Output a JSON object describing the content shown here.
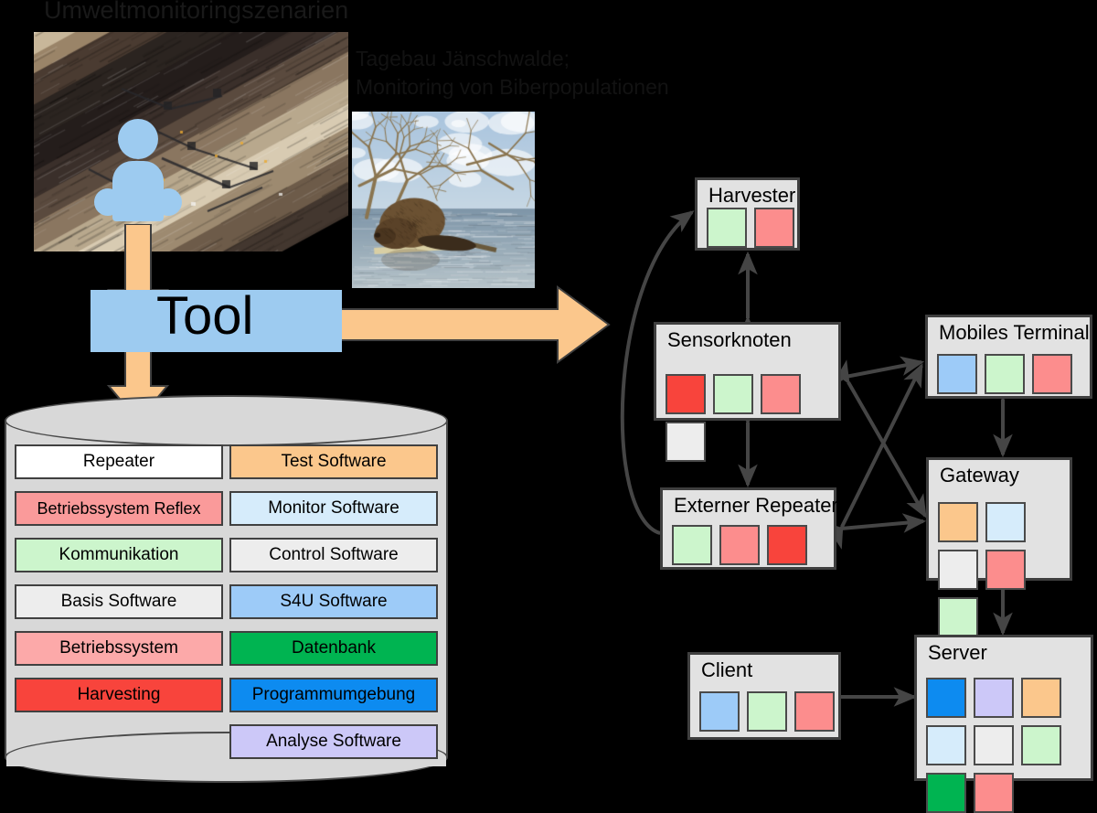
{
  "titles": {
    "main": "Umweltmonitoringszenarien",
    "sub": "Tagebau Jänschwalde;\nMonitoring  von Biberpopulationen"
  },
  "tool": {
    "label": "Tool"
  },
  "photos": {
    "mine": {
      "name": "open-pit-mine-photo",
      "alt": "Tagebau Jänschwalde open pit lignite mine"
    },
    "beaver": {
      "name": "beaver-photo",
      "alt": "Beaver at water edge"
    }
  },
  "person": {
    "name": "user-pictogram"
  },
  "arrows": {
    "person_to_tool": "down-arrow-person-to-tool",
    "tool_to_database": "down-arrow-tool-to-database",
    "tool_to_network": "right-arrow-tool-to-network"
  },
  "database": {
    "name": "software-repository-cylinder",
    "left_column": [
      {
        "label": "Repeater",
        "color": "#ffffff"
      },
      {
        "label": "Betriebssystem Reflex",
        "color": "#fa9a9a"
      },
      {
        "label": "Kommunikation",
        "color": "#ccf5cc"
      },
      {
        "label": "Basis Software",
        "color": "#ededed"
      },
      {
        "label": "Betriebssystem",
        "color": "#fca9a9"
      },
      {
        "label": "Harvesting",
        "color": "#f8443c"
      }
    ],
    "right_column": [
      {
        "label": "Test Software",
        "color": "#fbc78c"
      },
      {
        "label": "Monitor Software",
        "color": "#d6ecfb"
      },
      {
        "label": "Control Software",
        "color": "#ededed"
      },
      {
        "label": "S4U Software",
        "color": "#9dcbf8"
      },
      {
        "label": "Datenbank",
        "color": "#00b451"
      },
      {
        "label": "Programmumgebung",
        "color": "#0d8bf0"
      },
      {
        "label": "Analyse Software",
        "color": "#ccc8f8"
      }
    ]
  },
  "network": {
    "nodes": [
      {
        "id": "harvester",
        "label": "Harvester",
        "cells": [
          "#ccf5cc",
          "#fc8d8d"
        ]
      },
      {
        "id": "mobiles-terminal",
        "label": "Mobiles Terminal",
        "cells": [
          "#9dcbf8",
          "#ccf5cc",
          "#fc8d8d"
        ]
      },
      {
        "id": "sensorknoten",
        "label": "Sensorknoten",
        "cells": [
          "#f8443c",
          "#ccf5cc",
          "#fc8d8d",
          "#ededed"
        ]
      },
      {
        "id": "gateway",
        "label": "Gateway",
        "cells": [
          "#fbc78c",
          "#d6ecfb",
          "#ededed",
          "#fc8d8d",
          "#ccf5cc"
        ]
      },
      {
        "id": "externer-repeater",
        "label": "Externer Repeater",
        "cells": [
          "#ccf5cc",
          "#fc8d8d",
          "#f8443c"
        ]
      },
      {
        "id": "server",
        "label": "Server",
        "cells": [
          "#0d8bf0",
          "#ccc8f8",
          "#fbc78c",
          "#d6ecfb",
          "#ededed",
          "#ccf5cc",
          "#00b451",
          "#fc8d8d"
        ]
      },
      {
        "id": "client",
        "label": "Client",
        "cells": [
          "#9dcbf8",
          "#ccf5cc",
          "#fc8d8d"
        ]
      }
    ],
    "links": [
      {
        "from": "sensorknoten",
        "to": "harvester",
        "style": "straight"
      },
      {
        "from": "sensorknoten",
        "to": "externer-repeater",
        "style": "straight"
      },
      {
        "from": "externer-repeater",
        "to": "harvester",
        "style": "curved"
      },
      {
        "from": "sensorknoten",
        "to": "mobiles-terminal",
        "style": "straight"
      },
      {
        "from": "sensorknoten",
        "to": "gateway",
        "style": "straight"
      },
      {
        "from": "externer-repeater",
        "to": "mobiles-terminal",
        "style": "straight"
      },
      {
        "from": "externer-repeater",
        "to": "gateway",
        "style": "straight"
      },
      {
        "from": "mobiles-terminal",
        "to": "gateway",
        "style": "straight"
      },
      {
        "from": "gateway",
        "to": "server",
        "style": "straight"
      },
      {
        "from": "client",
        "to": "server",
        "style": "straight"
      }
    ]
  },
  "colors": {
    "accent_blue": "#9dcbf0",
    "accent_orange": "#fbc78c",
    "node_fill": "#e2e2e2",
    "node_border": "#3f3f3f",
    "background": "#000000"
  }
}
